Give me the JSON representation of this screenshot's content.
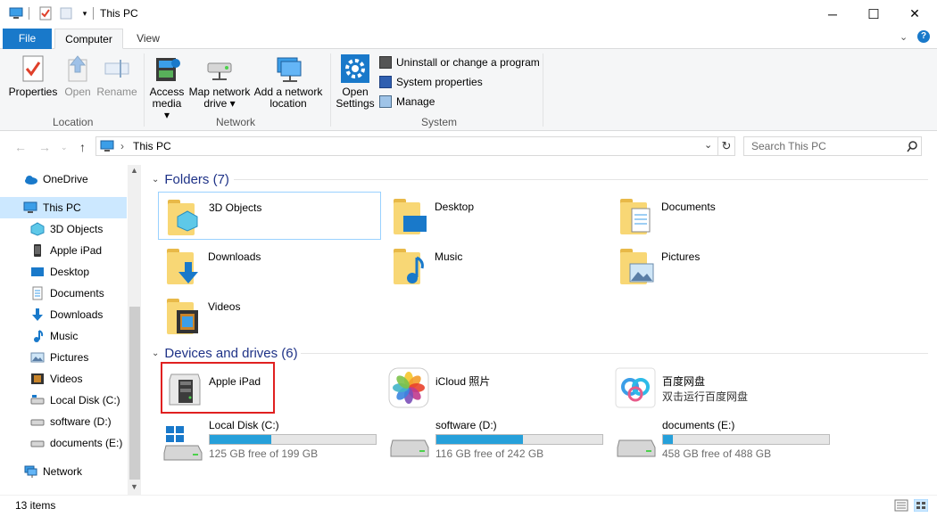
{
  "window": {
    "title": "This PC",
    "minimize": "─",
    "maximize": "☐",
    "close": "✕"
  },
  "tabs": {
    "file": "File",
    "computer": "Computer",
    "view": "View"
  },
  "ribbon": {
    "location": {
      "label": "Location",
      "properties": "Properties",
      "open": "Open",
      "rename": "Rename"
    },
    "network": {
      "label": "Network",
      "access_media_1": "Access",
      "access_media_2": "media ▾",
      "map_drive_1": "Map network",
      "map_drive_2": "drive ▾",
      "add_location_1": "Add a network",
      "add_location_2": "location"
    },
    "system": {
      "label": "System",
      "open_settings_1": "Open",
      "open_settings_2": "Settings",
      "uninstall": "Uninstall or change a program",
      "system_properties": "System properties",
      "manage": "Manage"
    }
  },
  "address": {
    "path_sep": "›",
    "path": "This PC",
    "search_placeholder": "Search This PC"
  },
  "nav": {
    "items": [
      {
        "label": "OneDrive",
        "icon": "onedrive-icon"
      },
      {
        "label": "This PC",
        "icon": "pc-icon",
        "selected": true
      },
      {
        "label": "3D Objects",
        "icon": "3d-objects-icon"
      },
      {
        "label": "Apple iPad",
        "icon": "ipad-icon"
      },
      {
        "label": "Desktop",
        "icon": "desktop-icon"
      },
      {
        "label": "Documents",
        "icon": "documents-icon"
      },
      {
        "label": "Downloads",
        "icon": "downloads-icon"
      },
      {
        "label": "Music",
        "icon": "music-icon"
      },
      {
        "label": "Pictures",
        "icon": "pictures-icon"
      },
      {
        "label": "Videos",
        "icon": "videos-icon"
      },
      {
        "label": "Local Disk (C:)",
        "icon": "drive-icon"
      },
      {
        "label": "software (D:)",
        "icon": "drive-icon"
      },
      {
        "label": "documents (E:)",
        "icon": "drive-icon"
      },
      {
        "label": "Network",
        "icon": "network-icon"
      }
    ]
  },
  "content": {
    "folders_header": "Folders (7)",
    "folders": [
      {
        "name": "3D Objects"
      },
      {
        "name": "Desktop"
      },
      {
        "name": "Documents"
      },
      {
        "name": "Downloads"
      },
      {
        "name": "Music"
      },
      {
        "name": "Pictures"
      },
      {
        "name": "Videos"
      }
    ],
    "devices_header": "Devices and drives (6)",
    "devices": [
      {
        "name": "Apple iPad",
        "subtitle": ""
      },
      {
        "name": "iCloud 照片",
        "subtitle": ""
      },
      {
        "name": "百度网盘",
        "subtitle": "双击运行百度网盘"
      }
    ],
    "drives": [
      {
        "name": "Local Disk (C:)",
        "free": "125 GB free of 199 GB",
        "used_fraction": 0.37
      },
      {
        "name": "software (D:)",
        "free": "116 GB free of 242 GB",
        "used_fraction": 0.52
      },
      {
        "name": "documents (E:)",
        "free": "458 GB free of 488 GB",
        "used_fraction": 0.06
      }
    ],
    "highlight_color": "#e02020"
  },
  "status": {
    "items": "13 items"
  }
}
